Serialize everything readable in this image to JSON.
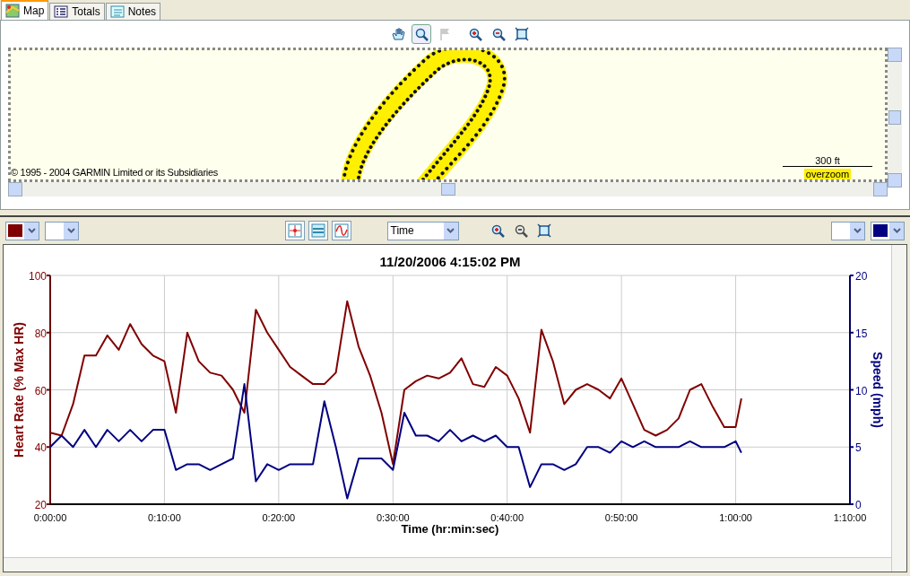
{
  "tabs": [
    {
      "label": "Map",
      "kind": "map",
      "selected": true
    },
    {
      "label": "Totals",
      "kind": "totals",
      "selected": false
    },
    {
      "label": "Notes",
      "kind": "notes",
      "selected": false
    }
  ],
  "map_tools": [
    {
      "kind": "hand",
      "selected": false,
      "disabled": false
    },
    {
      "kind": "magnifier",
      "selected": true,
      "disabled": false
    },
    {
      "kind": "flag",
      "selected": false,
      "disabled": true
    },
    {
      "kind": "zoom-in",
      "selected": false,
      "disabled": false
    },
    {
      "kind": "zoom-out",
      "selected": false,
      "disabled": false
    },
    {
      "kind": "fit",
      "selected": false,
      "disabled": false
    }
  ],
  "map": {
    "copyright": "© 1995 - 2004 GARMIN Limited or its Subsidiaries",
    "scale": "300 ft",
    "zoom_note": "overzoom"
  },
  "chart_toolbar": {
    "color_pickers": [
      {
        "color": "#800000"
      },
      {
        "color": "#000080"
      }
    ],
    "modes": [
      {
        "kind": "crosshair",
        "selected": false
      },
      {
        "kind": "stripes",
        "selected": false
      },
      {
        "kind": "wave",
        "selected": false
      }
    ],
    "x_axis_select": "Time",
    "zoom_tools": [
      {
        "kind": "zoom-in",
        "disabled": false
      },
      {
        "kind": "zoom-out",
        "disabled": true
      },
      {
        "kind": "fit",
        "disabled": false
      }
    ]
  },
  "chart": {
    "chart_data": {
      "type": "line",
      "grid": true,
      "title": "11/20/2006 4:15:02 PM",
      "xlabel": "Time (hr:min:sec)",
      "ylabel": "Heart Rate (% Max HR)",
      "y2label": "Speed (mph)",
      "x": [
        0,
        1,
        2,
        3,
        4,
        5,
        6,
        7,
        8,
        9,
        10,
        11,
        12,
        13,
        14,
        15,
        16,
        17,
        18,
        19,
        20,
        21,
        22,
        23,
        24,
        25,
        26,
        27,
        28,
        29,
        30,
        31,
        32,
        33,
        34,
        35,
        36,
        37,
        38,
        39,
        40,
        41,
        42,
        43,
        44,
        45,
        46,
        47,
        48,
        49,
        50,
        51,
        52,
        53,
        54,
        55,
        56,
        57,
        58,
        59,
        60,
        60.5
      ],
      "series": [
        {
          "color": "#800000",
          "values": [
            45,
            44,
            55,
            72,
            72,
            79,
            74,
            83,
            76,
            72,
            70,
            52,
            80,
            70,
            66,
            65,
            60,
            52,
            88,
            80,
            74,
            68,
            65,
            62,
            62,
            66,
            91,
            75,
            65,
            52,
            34,
            60,
            63,
            65,
            64,
            66,
            71,
            62,
            61,
            68,
            65,
            57,
            45,
            81,
            70,
            55,
            60,
            62,
            60,
            57,
            64,
            55,
            46,
            44,
            46,
            50,
            60,
            62,
            54,
            47,
            47,
            57
          ]
        },
        {
          "color": "#000080",
          "axis": "y2",
          "values": [
            5,
            6,
            5,
            6.5,
            5,
            6.5,
            5.5,
            6.5,
            5.5,
            6.5,
            6.5,
            3,
            3.5,
            3.5,
            3,
            3.5,
            4,
            10.5,
            2,
            3.5,
            3,
            3.5,
            3.5,
            3.5,
            9,
            5,
            0.5,
            4,
            4,
            4,
            3,
            8,
            6,
            6,
            5.5,
            6.5,
            5.5,
            6,
            5.5,
            6,
            5,
            5,
            1.5,
            3.5,
            3.5,
            3,
            3.5,
            5,
            5,
            4.5,
            5.5,
            5,
            5.5,
            5,
            5,
            5,
            5.5,
            5,
            5,
            5,
            5.5,
            4.5
          ]
        }
      ],
      "xlim": [
        0,
        70
      ],
      "ylim": [
        20,
        100
      ],
      "y2lim": [
        0,
        20
      ],
      "xticks": [
        {
          "value": 0,
          "label": "0:00:00"
        },
        {
          "value": 10,
          "label": "0:10:00"
        },
        {
          "value": 20,
          "label": "0:20:00"
        },
        {
          "value": 30,
          "label": "0:30:00"
        },
        {
          "value": 40,
          "label": "0:40:00"
        },
        {
          "value": 50,
          "label": "0:50:00"
        },
        {
          "value": 60,
          "label": "1:00:00"
        },
        {
          "value": 70,
          "label": "1:10:00"
        }
      ],
      "yticks": [
        20,
        40,
        60,
        80,
        100
      ],
      "y2ticks": [
        0,
        5,
        10,
        15,
        20
      ]
    }
  }
}
